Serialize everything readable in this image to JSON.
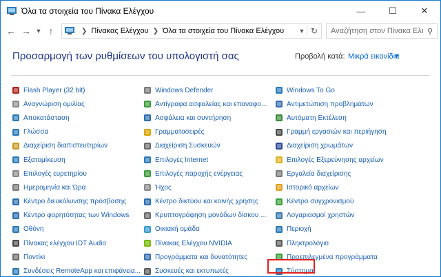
{
  "window": {
    "title": "Όλα τα στοιχεία του Πίνακα Ελέγχου",
    "min_icon": "minimize-icon",
    "max_icon": "maximize-icon",
    "close_icon": "close-icon"
  },
  "address": {
    "crumbs": [
      "Πίνακας Ελέγχου",
      "Όλα τα στοιχεία του Πίνακα Ελέγχου"
    ]
  },
  "search": {
    "placeholder": "Αναζήτηση στον Πίνακα Ελέγ..."
  },
  "header": {
    "heading": "Προσαρμογή των ρυθμίσεων του υπολογιστή σας",
    "view_by_label": "Προβολή κατά:",
    "view_by_value": "Μικρά εικονίδια"
  },
  "items": [
    {
      "label": "Flash Player (32 bit)",
      "icon": "flash-icon",
      "color": "#b3261e"
    },
    {
      "label": "Windows Defender",
      "icon": "defender-icon",
      "color": "#7a7a7a"
    },
    {
      "label": "Windows To Go",
      "icon": "windows-to-go-icon",
      "color": "#2a7ab8"
    },
    {
      "label": "Αναγνώριση ομιλίας",
      "icon": "microphone-icon",
      "color": "#8a8a8a"
    },
    {
      "label": "Αντίγραφα ασφαλείας και επαναφο...",
      "icon": "backup-icon",
      "color": "#3a9a3a"
    },
    {
      "label": "Αντιμετώπιση προβλημάτων",
      "icon": "troubleshoot-icon",
      "color": "#3a6fb0"
    },
    {
      "label": "Αποκατάσταση",
      "icon": "recovery-icon",
      "color": "#2a7ab8"
    },
    {
      "label": "Ασφάλεια και συντήρηση",
      "icon": "flag-icon",
      "color": "#2a6fb0"
    },
    {
      "label": "Αυτόματη Εκτέλεση",
      "icon": "autoplay-icon",
      "color": "#3a8a3a"
    },
    {
      "label": "Γλώσσα",
      "icon": "language-icon",
      "color": "#2a7ab8"
    },
    {
      "label": "Γραμματοσειρές",
      "icon": "fonts-icon",
      "color": "#d9a400"
    },
    {
      "label": "Γραμμή εργασιών και περιήγηση",
      "icon": "taskbar-icon",
      "color": "#4a4a4a"
    },
    {
      "label": "Διαχείριση διαπιστευτηρίων",
      "icon": "credentials-icon",
      "color": "#c89a20"
    },
    {
      "label": "Διαχείριση Συσκευών",
      "icon": "device-manager-icon",
      "color": "#6a6a6a"
    },
    {
      "label": "Διαχείριση χρωμάτων",
      "icon": "color-management-icon",
      "color": "#2a4a9a"
    },
    {
      "label": "Εξατομίκευση",
      "icon": "personalization-icon",
      "color": "#2a7ab8"
    },
    {
      "label": "Επιλογές Internet",
      "icon": "internet-options-icon",
      "color": "#2a7ab8"
    },
    {
      "label": "Επιλογές Εξερεύνησης αρχείων",
      "icon": "folder-options-icon",
      "color": "#e0b020"
    },
    {
      "label": "Επιλογές ευρετηρίου",
      "icon": "indexing-icon",
      "color": "#8a8a8a"
    },
    {
      "label": "Επιλογές παροχής ενέργειας",
      "icon": "power-icon",
      "color": "#3a9a3a"
    },
    {
      "label": "Εργαλεία διαχείρισης",
      "icon": "admin-tools-icon",
      "color": "#7a7a7a"
    },
    {
      "label": "Ημερομηνία και Ώρα",
      "icon": "clock-icon",
      "color": "#7a7a7a"
    },
    {
      "label": "Ήχος",
      "icon": "speaker-icon",
      "color": "#8a8a8a"
    },
    {
      "label": "Ιστορικό αρχείων",
      "icon": "file-history-icon",
      "color": "#e0a020"
    },
    {
      "label": "Κέντρο διευκόλυνσης πρόσβασης",
      "icon": "ease-of-access-icon",
      "color": "#2a6fb0"
    },
    {
      "label": "Κέντρο δικτύου και κοινής χρήσης",
      "icon": "network-icon",
      "color": "#2a6fb0"
    },
    {
      "label": "Κέντρο συγχρονισμού",
      "icon": "sync-icon",
      "color": "#3aa03a"
    },
    {
      "label": "Κέντρο φορητότητας των Windows",
      "icon": "mobility-icon",
      "color": "#2a6fb0"
    },
    {
      "label": "Κρυπτογράφηση μονάδων δίσκου ...",
      "icon": "bitlocker-icon",
      "color": "#6a6a6a"
    },
    {
      "label": "Λογαριασμοί χρηστών",
      "icon": "user-accounts-icon",
      "color": "#3a7ab0"
    },
    {
      "label": "Οθόνη",
      "icon": "display-icon",
      "color": "#2a7ab8"
    },
    {
      "label": "Οικιακή ομάδα",
      "icon": "homegroup-icon",
      "color": "#3a9ad0"
    },
    {
      "label": "Περιοχή",
      "icon": "region-icon",
      "color": "#2a7ab8"
    },
    {
      "label": "Πίνακας ελέγχου IDT Audio",
      "icon": "idt-audio-icon",
      "color": "#4a4a4a"
    },
    {
      "label": "Πίνακας Ελέγχου NVIDIA",
      "icon": "nvidia-icon",
      "color": "#76b900"
    },
    {
      "label": "Πληκτρολόγιο",
      "icon": "keyboard-icon",
      "color": "#5a5a5a"
    },
    {
      "label": "Ποντίκι",
      "icon": "mouse-icon",
      "color": "#6a6a6a"
    },
    {
      "label": "Προγράμματα και δυνατότητες",
      "icon": "programs-icon",
      "color": "#3a6fb0"
    },
    {
      "label": "Προεπιλεγμένα προγράμματα",
      "icon": "default-programs-icon",
      "color": "#3a9a3a"
    },
    {
      "label": "Συνδέσεις RemoteApp και επιφάνεια...",
      "icon": "remoteapp-icon",
      "color": "#2a7ab8"
    },
    {
      "label": "Συσκευές και εκτυπωτές",
      "icon": "printer-icon",
      "color": "#5a5a5a"
    },
    {
      "label": "Σύστημα",
      "icon": "system-icon",
      "color": "#2a7ab8"
    }
  ]
}
